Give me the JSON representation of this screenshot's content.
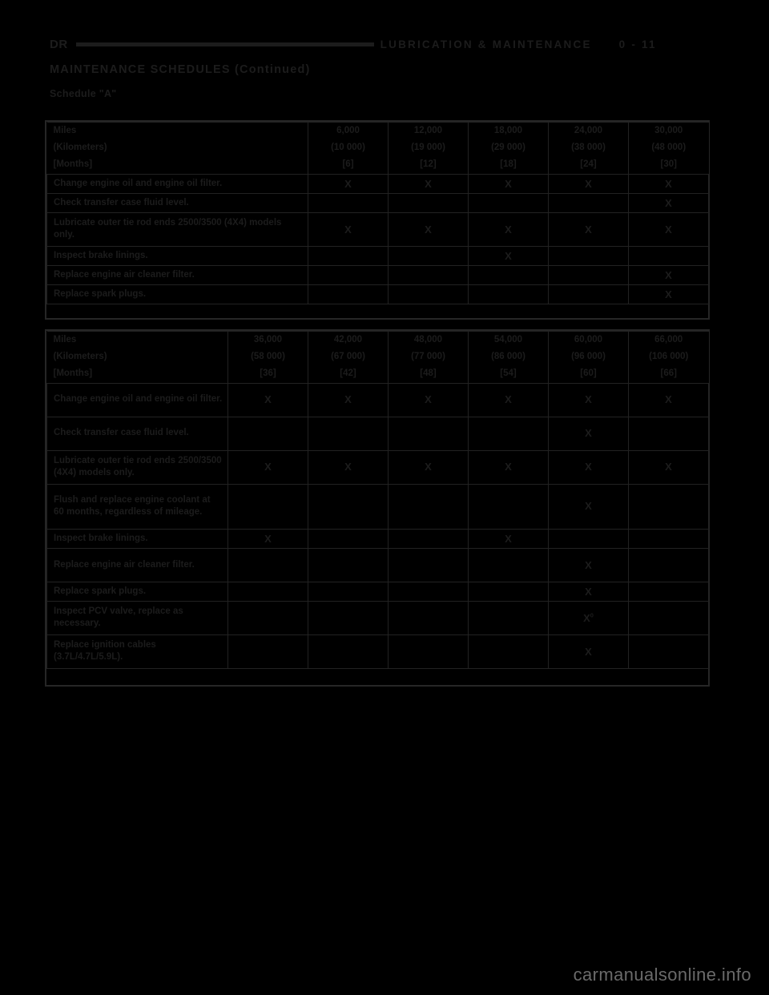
{
  "header": {
    "left_code": "DR",
    "section": "LUBRICATION & MAINTENANCE",
    "page_number": "0 - 11"
  },
  "section_title": "MAINTENANCE SCHEDULES (Continued)",
  "subsection_title": "Schedule \"A\"",
  "watermark": "carmanualsonline.info",
  "mark_symbol": "X",
  "table_a": {
    "row_labels": {
      "miles": "Miles",
      "kilometers": "(Kilometers)",
      "months": "[Months]"
    },
    "columns": [
      {
        "miles": "6,000",
        "kilometers": "(10 000)",
        "months": "[6]"
      },
      {
        "miles": "12,000",
        "kilometers": "(19 000)",
        "months": "[12]"
      },
      {
        "miles": "18,000",
        "kilometers": "(29 000)",
        "months": "[18]"
      },
      {
        "miles": "24,000",
        "kilometers": "(38 000)",
        "months": "[24]"
      },
      {
        "miles": "30,000",
        "kilometers": "(48 000)",
        "months": "[30]"
      }
    ],
    "rows": [
      {
        "task": "Change engine oil and engine oil filter.",
        "marks": [
          "X",
          "X",
          "X",
          "X",
          "X"
        ]
      },
      {
        "task": "Check transfer case fluid level.",
        "marks": [
          "",
          "",
          "",
          "",
          "X"
        ]
      },
      {
        "task": "Lubricate outer tie rod ends 2500/3500 (4X4) models only.",
        "marks": [
          "X",
          "X",
          "X",
          "X",
          "X"
        ]
      },
      {
        "task": "Inspect brake linings.",
        "marks": [
          "",
          "",
          "X",
          "",
          ""
        ]
      },
      {
        "task": "Replace engine air cleaner filter.",
        "marks": [
          "",
          "",
          "",
          "",
          "X"
        ]
      },
      {
        "task": "Replace spark plugs.",
        "marks": [
          "",
          "",
          "",
          "",
          "X"
        ]
      }
    ]
  },
  "table_b": {
    "row_labels": {
      "miles": "Miles",
      "kilometers": "(Kilometers)",
      "months": "[Months]"
    },
    "columns": [
      {
        "miles": "36,000",
        "kilometers": "(58 000)",
        "months": "[36]"
      },
      {
        "miles": "42,000",
        "kilometers": "(67 000)",
        "months": "[42]"
      },
      {
        "miles": "48,000",
        "kilometers": "(77 000)",
        "months": "[48]"
      },
      {
        "miles": "54,000",
        "kilometers": "(86 000)",
        "months": "[54]"
      },
      {
        "miles": "60,000",
        "kilometers": "(96 000)",
        "months": "[60]"
      },
      {
        "miles": "66,000",
        "kilometers": "(106 000)",
        "months": "[66]"
      }
    ],
    "rows": [
      {
        "task": "Change engine oil and engine oil filter.",
        "marks": [
          "X",
          "X",
          "X",
          "X",
          "X",
          "X"
        ]
      },
      {
        "task": "Check transfer case fluid level.",
        "marks": [
          "",
          "",
          "",
          "",
          "X",
          ""
        ]
      },
      {
        "task": "Lubricate outer tie rod ends 2500/3500 (4X4) models only.",
        "marks": [
          "X",
          "X",
          "X",
          "X",
          "X",
          "X"
        ]
      },
      {
        "task": "Flush and replace engine coolant at 60 months, regardless of mileage.",
        "marks": [
          "",
          "",
          "",
          "",
          "X",
          ""
        ]
      },
      {
        "task": "Inspect brake linings.",
        "marks": [
          "X",
          "",
          "",
          "X",
          "",
          ""
        ]
      },
      {
        "task": "Replace engine air cleaner filter.",
        "marks": [
          "",
          "",
          "",
          "",
          "X",
          ""
        ]
      },
      {
        "task": "Replace spark plugs.",
        "marks": [
          "",
          "",
          "",
          "",
          "X",
          ""
        ]
      },
      {
        "task": "Inspect PCV valve, replace as necessary.",
        "marks": [
          "",
          "",
          "",
          "",
          "X",
          ""
        ],
        "superscript_col": 4,
        "superscript": "0"
      },
      {
        "task": "Replace ignition cables (3.7L/4.7L/5.9L).",
        "marks": [
          "",
          "",
          "",
          "",
          "X",
          ""
        ]
      }
    ]
  }
}
